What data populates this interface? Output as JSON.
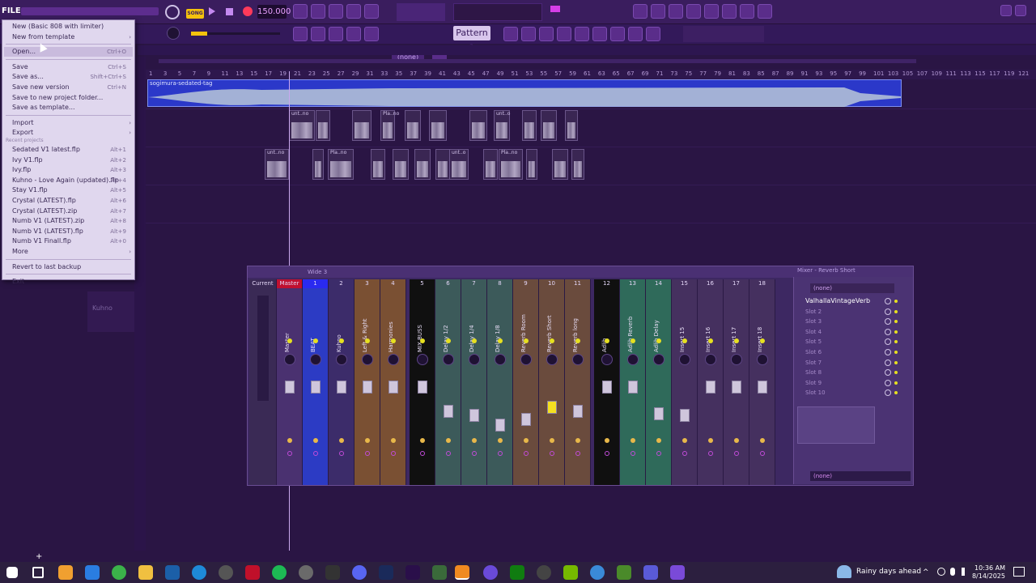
{
  "topbar": {
    "file_label": "FILE",
    "song_label": "SONG",
    "tempo": "150.000",
    "pattern": "Pattern 1",
    "none_label": "(none)"
  },
  "file_menu": {
    "items": [
      {
        "label": "New (Basic 808 with limiter)",
        "shortcut": "",
        "submenu": false
      },
      {
        "label": "New from template",
        "shortcut": "",
        "submenu": true
      },
      {
        "label": "Open...",
        "shortcut": "Ctrl+O",
        "submenu": false,
        "highlighted": true
      },
      {
        "label": "Save",
        "shortcut": "Ctrl+S",
        "submenu": false
      },
      {
        "label": "Save as...",
        "shortcut": "Shift+Ctrl+S",
        "submenu": false
      },
      {
        "label": "Save new version",
        "shortcut": "Ctrl+N",
        "submenu": false
      },
      {
        "label": "Save to new project folder...",
        "shortcut": "",
        "submenu": false
      },
      {
        "label": "Save as template...",
        "shortcut": "",
        "submenu": false
      },
      {
        "label": "Import",
        "shortcut": "",
        "submenu": true
      },
      {
        "label": "Export",
        "shortcut": "",
        "submenu": true
      }
    ],
    "recent_header": "Recent projects",
    "recent": [
      {
        "label": "Sedated V1 latest.flp",
        "shortcut": "Alt+1"
      },
      {
        "label": "Ivy V1.flp",
        "shortcut": "Alt+2"
      },
      {
        "label": "Ivy.flp",
        "shortcut": "Alt+3"
      },
      {
        "label": "Kuhno - Love Again (updated).flp",
        "shortcut": "Alt+4"
      },
      {
        "label": "Stay V1.flp",
        "shortcut": "Alt+5"
      },
      {
        "label": "Crystal (LATEST).flp",
        "shortcut": "Alt+6"
      },
      {
        "label": "Crystal (LATEST).zip",
        "shortcut": "Alt+7"
      },
      {
        "label": "Numb V1 (LATEST).zip",
        "shortcut": "Alt+8"
      },
      {
        "label": "Numb V1 (LATEST).flp",
        "shortcut": "Alt+9"
      },
      {
        "label": "Numb V1 Finall.flp",
        "shortcut": "Alt+0"
      }
    ],
    "more": "More",
    "revert": "Revert to last backup",
    "exit": "Exit"
  },
  "playlist": {
    "ruler": [
      "1",
      "3",
      "5",
      "7",
      "9",
      "11",
      "13",
      "15",
      "17",
      "19",
      "21",
      "23",
      "25",
      "27",
      "29",
      "31",
      "33",
      "35",
      "37",
      "39",
      "41",
      "43",
      "45",
      "47",
      "49",
      "51",
      "53",
      "55",
      "57",
      "59",
      "61",
      "63",
      "65",
      "67",
      "69",
      "71",
      "73",
      "75",
      "77",
      "79",
      "81",
      "83",
      "85",
      "87",
      "89",
      "91",
      "93",
      "95",
      "97",
      "99",
      "101",
      "103",
      "105",
      "107",
      "109",
      "111",
      "113",
      "115",
      "117",
      "119",
      "121"
    ],
    "audio_clip": "sogimura-sedated-tag",
    "clip_labels": [
      "unt..no",
      "Pla..no",
      "unt..o",
      "Pla..no",
      "unt..o"
    ],
    "side_label": "Kuhno"
  },
  "mixer": {
    "title": "Wide 3",
    "strips": [
      {
        "num": "Current",
        "name": "",
        "color": "#3a2a55"
      },
      {
        "num": "Master",
        "name": "Master",
        "color": "#4a3170"
      },
      {
        "num": "1",
        "name": "BEAT",
        "color": "#2c3bc4"
      },
      {
        "num": "2",
        "name": "Kuhno",
        "color": "#3c2c6a"
      },
      {
        "num": "3",
        "name": "Left & Right",
        "color": "#7a5033"
      },
      {
        "num": "4",
        "name": "Harmonies",
        "color": "#7a5033"
      },
      {
        "num": "5",
        "name": "MIX BUSS",
        "color": "#101010"
      },
      {
        "num": "6",
        "name": "Delay 1/2",
        "color": "#3c5a5a"
      },
      {
        "num": "7",
        "name": "Delay 1/4",
        "color": "#3c5a5a"
      },
      {
        "num": "8",
        "name": "Delay 1/8",
        "color": "#3c5a5a"
      },
      {
        "num": "9",
        "name": "Reverb Room",
        "color": "#6a4b3d"
      },
      {
        "num": "10",
        "name": "Reverb Short",
        "color": "#6a4b3d"
      },
      {
        "num": "11",
        "name": "Reverb long",
        "color": "#6a4b3d"
      },
      {
        "num": "12",
        "name": "Adlib",
        "color": "#101010"
      },
      {
        "num": "13",
        "name": "Adlib Reverb",
        "color": "#2f6a5a"
      },
      {
        "num": "14",
        "name": "Adlib Delay",
        "color": "#2f6a5a"
      },
      {
        "num": "15",
        "name": "Insert 15",
        "color": "#45305f"
      },
      {
        "num": "16",
        "name": "Insert 16",
        "color": "#45305f"
      },
      {
        "num": "17",
        "name": "Insert 17",
        "color": "#45305f"
      },
      {
        "num": "18",
        "name": "Insert 18",
        "color": "#45305f"
      }
    ]
  },
  "fx_panel": {
    "title": "Mixer - Reverb Short",
    "preset": "(none)",
    "slots": [
      "ValhallaVintageVerb",
      "Slot 2",
      "Slot 3",
      "Slot 4",
      "Slot 5",
      "Slot 6",
      "Slot 7",
      "Slot 8",
      "Slot 9",
      "Slot 10"
    ],
    "output": "(none)"
  },
  "taskbar": {
    "weather": "Rainy days ahead",
    "time": "10:36 AM",
    "date": "8/14/2025"
  }
}
